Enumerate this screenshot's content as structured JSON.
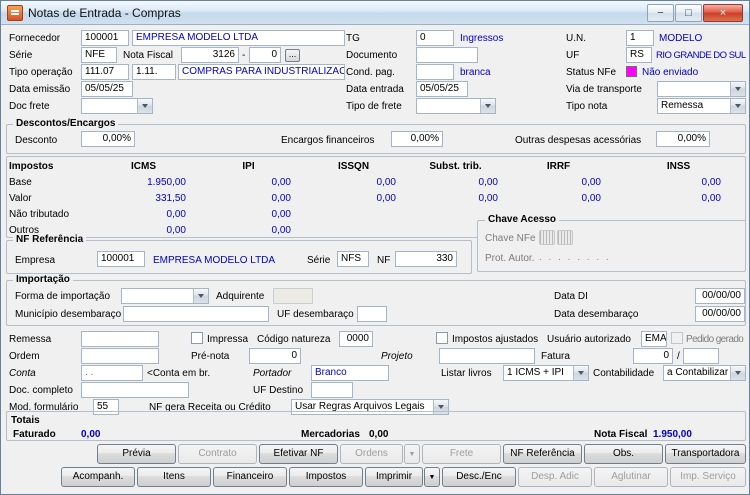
{
  "window": {
    "title": "Notas de Entrada - Compras",
    "minimize_glyph": "−",
    "maximize_glyph": "□",
    "close_glyph": "×"
  },
  "colors": {
    "value_blue": "#0000cc",
    "status_nfe": "#ff00ff"
  },
  "header": {
    "fornecedor": {
      "label": "Fornecedor",
      "code": "100001",
      "name": "EMPRESA MODELO LTDA"
    },
    "tg": {
      "label": "TG",
      "value": "0",
      "desc": "Ingressos"
    },
    "un": {
      "label": "U.N.",
      "value": "1",
      "desc": "MODELO"
    },
    "serie": {
      "label": "Série",
      "value": "NFE"
    },
    "nota_fiscal": {
      "label": "Nota Fiscal",
      "numero": "3126",
      "separador": "-",
      "sub": "0",
      "browse": "..."
    },
    "documento": {
      "label": "Documento",
      "value": ""
    },
    "uf": {
      "label": "UF",
      "value": "RS",
      "desc": "RIO GRANDE DO SUL"
    },
    "tipo_operacao": {
      "label": "Tipo operação",
      "codigo": "111.07",
      "natureza": "1.11.",
      "desc": "COMPRAS PARA INDUSTRIALIZACA"
    },
    "cond_pag": {
      "label": "Cond. pag.",
      "value": "",
      "desc": "branca"
    },
    "status_nfe": {
      "label": "Status NFe",
      "desc": "Não enviado"
    },
    "data_emissao": {
      "label": "Data emissão",
      "value": "05/05/25"
    },
    "data_entrada": {
      "label": "Data entrada",
      "value": "05/05/25"
    },
    "via_transporte": {
      "label": "Via de transporte",
      "value": ""
    },
    "doc_frete": {
      "label": "Doc frete",
      "value": ""
    },
    "tipo_frete": {
      "label": "Tipo de frete",
      "value": ""
    },
    "tipo_nota": {
      "label": "Tipo nota",
      "value": "Remessa"
    }
  },
  "descontos": {
    "title": "Descontos/Encargos",
    "desconto_label": "Desconto",
    "desconto": "0,00%",
    "encargos_label": "Encargos financeiros",
    "encargos": "0,00%",
    "outras_label": "Outras despesas acessórias",
    "outras": "0,00%"
  },
  "impostos": {
    "title": "Impostos",
    "columns": [
      "ICMS",
      "IPI",
      "ISSQN",
      "Subst. trib.",
      "IRRF",
      "INSS"
    ],
    "rows": [
      {
        "label": "Base",
        "values": [
          "1.950,00",
          "0,00",
          "0,00",
          "0,00",
          "0,00",
          "0,00"
        ]
      },
      {
        "label": "Valor",
        "values": [
          "331,50",
          "0,00",
          "0,00",
          "0,00",
          "0,00",
          "0,00"
        ]
      },
      {
        "label": "Não tributado",
        "values": [
          "0,00",
          "0,00",
          "",
          "",
          "",
          ""
        ]
      },
      {
        "label": "Outros",
        "values": [
          "0,00",
          "0,00",
          "",
          "",
          "",
          ""
        ]
      }
    ]
  },
  "chave_acesso": {
    "title": "Chave Acesso",
    "chave_label": "Chave NFe",
    "prot_label": "Prot. Autor.",
    "prot_mask": ".  .  .  .  .  .  .  ."
  },
  "nf_referencia": {
    "title": "NF Referência",
    "empresa_label": "Empresa",
    "empresa_code": "100001",
    "empresa_name": "EMPRESA MODELO LTDA",
    "serie_label": "Série",
    "serie": "NFS",
    "nf_label": "NF",
    "nf": "330"
  },
  "importacao": {
    "title": "Importação",
    "forma_label": "Forma de importação",
    "forma": "",
    "adquirente_label": "Adquirente",
    "adquirente": "",
    "data_di_label": "Data DI",
    "data_di": "00/00/00",
    "municipio_label": "Município desembaraço",
    "municipio": "",
    "uf_desembaraco_label": "UF desembaraço",
    "uf_desembaraco": "",
    "data_desembaraco_label": "Data desembaraço",
    "data_desembaraco": "00/00/00"
  },
  "detalhes": {
    "remessa_label": "Remessa",
    "remessa": "",
    "impressa_label": "Impressa",
    "codigo_natureza_label": "Código natureza",
    "codigo_natureza": "0000",
    "impostos_ajustados_label": "Impostos ajustados",
    "usuario_autorizado_label": "Usuário autorizado",
    "usuario_autorizado": "EMA",
    "pedido_gerado_label": "Pedido gerado",
    "ordem_label": "Ordem",
    "ordem": "",
    "pre_nota_label": "Pré-nota",
    "pre_nota": "0",
    "projeto_label": "Projeto",
    "projeto": "",
    "fatura_label": "Fatura",
    "fatura": "0",
    "fatura_sep": "/",
    "fatura_parcela": "",
    "conta_label": "Conta",
    "conta": ".    .",
    "conta_hint": "<Conta em br.",
    "portador_label": "Portador",
    "portador": "Branco",
    "listar_livros_label": "Listar livros",
    "listar_livros": "1 ICMS + IPI",
    "contabilidade_label": "Contabilidade",
    "contabilidade": "a Contabilizar",
    "doc_completo_label": "Doc. completo",
    "doc_completo": "",
    "uf_destino_label": "UF Destino",
    "uf_destino": "",
    "mod_formulario_label": "Mod. formulário",
    "mod_formulario": "55",
    "nf_gera_label": "NF gera Receita ou Crédito",
    "nf_gera": "Usar Regras Arquivos Legais"
  },
  "totais": {
    "title": "Totais",
    "faturado_label": "Faturado",
    "faturado": "0,00",
    "mercadorias_label": "Mercadorias",
    "mercadorias": "0,00",
    "nota_fiscal_label": "Nota Fiscal",
    "nota_fiscal": "1.950,00"
  },
  "buttons": {
    "previa": "Prévia",
    "contrato": "Contrato",
    "efetivar_nf": "Efetivar NF",
    "ordens": "Ordens",
    "frete": "Frete",
    "nf_referencia": "NF Referência",
    "obs": "Obs.",
    "transportadora": "Transportadora",
    "acompanh": "Acompanh.",
    "itens": "Itens",
    "financeiro": "Financeiro",
    "impostos": "Impostos",
    "imprimir": "Imprimir",
    "desc_enc": "Desc./Enc",
    "desp_adic": "Desp. Adic",
    "aglutinar": "Aglutinar",
    "imp_servico": "Imp. Serviço"
  }
}
